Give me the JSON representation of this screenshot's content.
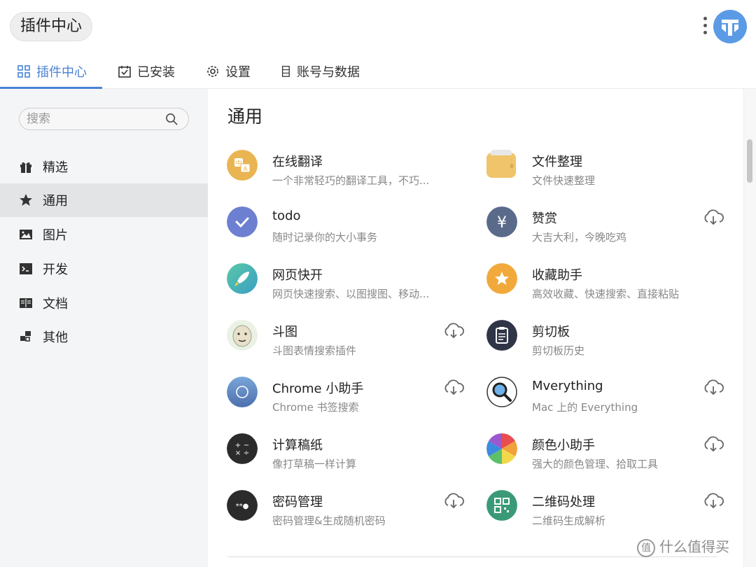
{
  "header": {
    "title": "插件中心"
  },
  "tabs": [
    {
      "label": "插件中心",
      "icon": "grid-icon",
      "active": true
    },
    {
      "label": "已安装",
      "icon": "calendar-check-icon"
    },
    {
      "label": "设置",
      "icon": "gear-icon"
    },
    {
      "label": "账号与数据",
      "icon": "database-icon"
    }
  ],
  "search": {
    "placeholder": "搜索"
  },
  "sidebar": {
    "items": [
      {
        "label": "精选",
        "icon": "gift-icon"
      },
      {
        "label": "通用",
        "icon": "star-icon",
        "active": true
      },
      {
        "label": "图片",
        "icon": "image-icon"
      },
      {
        "label": "开发",
        "icon": "terminal-icon"
      },
      {
        "label": "文档",
        "icon": "book-icon"
      },
      {
        "label": "其他",
        "icon": "blocks-icon"
      }
    ]
  },
  "main": {
    "section_title": "通用",
    "plugins": [
      {
        "name": "在线翻译",
        "desc": "一个非常轻巧的翻译工具，不巧...",
        "icon": "translate-icon",
        "color": "#e9b452"
      },
      {
        "name": "文件整理",
        "desc": "文件快速整理",
        "icon": "wallet-icon",
        "color": "#f0c46a"
      },
      {
        "name": "todo",
        "desc": "随时记录你的大小事务",
        "icon": "check-icon",
        "color": "#6c7fd0"
      },
      {
        "name": "赞赏",
        "desc": "大吉大利，今晚吃鸡",
        "icon": "yen-icon",
        "color": "#5a6a8a",
        "download": true
      },
      {
        "name": "网页快开",
        "desc": "网页快速搜索、以图搜图、移动...",
        "icon": "rocket-icon",
        "color": "#3cb7a4"
      },
      {
        "name": "收藏助手",
        "desc": "高效收藏、快速搜索、直接粘贴",
        "icon": "star-badge-icon",
        "color": "#f2a93b"
      },
      {
        "name": "斗图",
        "desc": "斗图表情搜索插件",
        "icon": "meme-face-icon",
        "color": "#cfe3c9",
        "download": true
      },
      {
        "name": "剪切板",
        "desc": "剪切板历史",
        "icon": "clipboard-icon",
        "color": "#2f3447"
      },
      {
        "name": "Chrome 小助手",
        "desc": "Chrome 书签搜索",
        "icon": "chrome-icon",
        "color": "#5b7fc2",
        "download": true
      },
      {
        "name": "Mverything",
        "desc": "Mac 上的 Everything",
        "icon": "magnifier-icon",
        "color": "#ffffff",
        "download": true
      },
      {
        "name": "计算稿纸",
        "desc": "像打草稿一样计算",
        "icon": "calculator-icon",
        "color": "#2b2b2b"
      },
      {
        "name": "颜色小助手",
        "desc": "强大的颜色管理、拾取工具",
        "icon": "color-wheel-icon",
        "color": "#e94e4e",
        "download": true
      },
      {
        "name": "密码管理",
        "desc": "密码管理&生成随机密码",
        "icon": "password-icon",
        "color": "#2b2b2b",
        "download": true
      },
      {
        "name": "二维码处理",
        "desc": "二维码生成解析",
        "icon": "qrcode-icon",
        "color": "#3a9a78",
        "download": true
      }
    ]
  },
  "watermark": {
    "text": "什么值得买",
    "mark": "值"
  },
  "colors": {
    "accent": "#4a82d4",
    "sidebar_bg": "#f4f5f7",
    "active_item_bg": "#e3e4e6"
  }
}
